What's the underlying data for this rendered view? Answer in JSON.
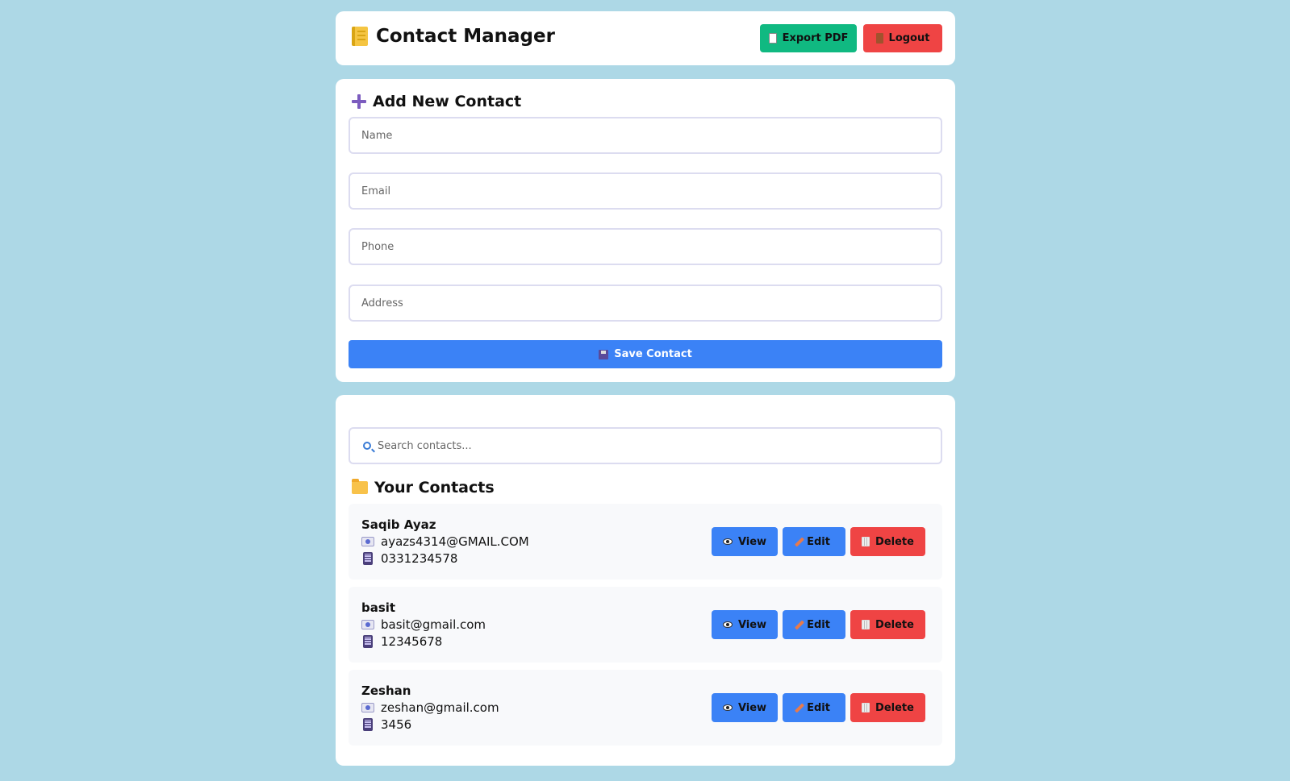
{
  "header": {
    "title": "Contact Manager",
    "export_label": "Export PDF",
    "logout_label": "Logout"
  },
  "add_form": {
    "title": "Add New Contact",
    "name_placeholder": "Name",
    "email_placeholder": "Email",
    "phone_placeholder": "Phone",
    "address_placeholder": "Address",
    "save_label": "Save Contact"
  },
  "list": {
    "search_placeholder": "Search contacts...",
    "title": "Your Contacts",
    "view_label": "View",
    "edit_label": "Edit",
    "delete_label": "Delete",
    "contacts": [
      {
        "name": "Saqib Ayaz",
        "email": "ayazs4314@GMAIL.COM",
        "phone": "0331234578"
      },
      {
        "name": "basit",
        "email": "basit@gmail.com",
        "phone": "12345678"
      },
      {
        "name": "Zeshan",
        "email": "zeshan@gmail.com",
        "phone": "3456"
      }
    ]
  },
  "colors": {
    "background": "#add8e6",
    "primary": "#3b82f6",
    "success": "#10b981",
    "danger": "#ef4444"
  },
  "icons": {
    "app": "notebook-icon",
    "export": "document-icon",
    "logout": "door-icon",
    "add": "plus-icon",
    "save": "floppy-disk-icon",
    "search": "search-icon",
    "contacts": "folder-icon",
    "email": "mail-icon",
    "phone": "phone-icon",
    "view": "eye-icon",
    "edit": "pencil-icon",
    "delete": "trash-icon"
  }
}
